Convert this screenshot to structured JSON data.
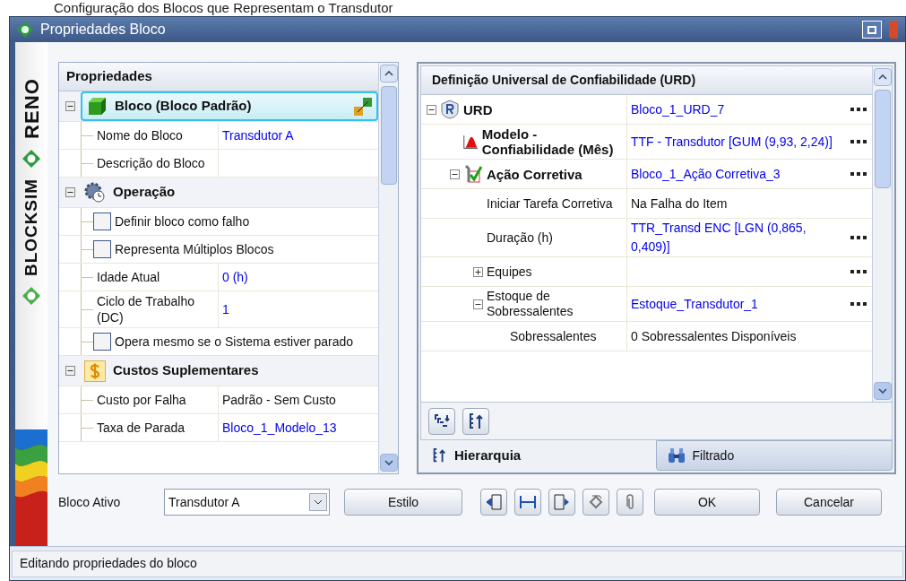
{
  "caption": "Configuração dos Blocos que Representam o Transdutor",
  "window": {
    "title": "Propriedades Bloco"
  },
  "brand": {
    "product": "BLOCKSIM",
    "company": "RENO"
  },
  "properties": {
    "header": "Propriedades",
    "categories": [
      {
        "kind": "block",
        "label": "Bloco (Bloco Padrão)",
        "expanded": true,
        "selected": true,
        "children": [
          {
            "kind": "property",
            "label": "Nome do Bloco",
            "value": "Transdutor A",
            "link": true
          },
          {
            "kind": "property",
            "label": "Descrição do Bloco"
          }
        ]
      },
      {
        "kind": "operation",
        "label": "Operação",
        "expanded": true,
        "selected": false,
        "children": [
          {
            "kind": "checkbox",
            "label": "Definir bloco como falho",
            "checked": false
          },
          {
            "kind": "checkbox",
            "label": "Representa Múltiplos Blocos",
            "checked": false
          },
          {
            "kind": "property",
            "label": "Idade Atual",
            "value": "0 (h)",
            "link": true
          },
          {
            "kind": "property",
            "label": "Ciclo de Trabalho (DC)",
            "value": "1",
            "link": true
          },
          {
            "kind": "checkbox",
            "label": "Opera mesmo se o Sistema estiver parado",
            "checked": false
          }
        ]
      },
      {
        "kind": "costs",
        "label": "Custos Suplementares",
        "expanded": true,
        "selected": false,
        "children": [
          {
            "kind": "property",
            "label": "Custo por Falha",
            "value": "Padrão - Sem Custo",
            "link": false
          },
          {
            "kind": "property",
            "label": "Taxa de Parada",
            "value": "Bloco_1_Modelo_13",
            "link": true
          }
        ]
      }
    ]
  },
  "urd": {
    "header": "Definição Universal de Confiabilidade (URD)",
    "tree": [
      {
        "kind": "urd",
        "label": "URD",
        "bold": true,
        "value": "Bloco_1_URD_7",
        "link": true,
        "more": true,
        "expanded": true,
        "children": [
          {
            "kind": "model",
            "label": "Modelo - Confiabilidade (Mês)",
            "bold": true,
            "value": "TTF - Transdutor [GUM (9,93, 2,24)]",
            "link": true,
            "more": true
          },
          {
            "kind": "action",
            "label": "Ação Corretiva",
            "bold": true,
            "value": "Bloco_1_Ação Corretiva_3",
            "link": true,
            "more": true,
            "expanded": true,
            "children": [
              {
                "label": "Iniciar Tarefa Corretiva",
                "bold": false,
                "value": "Na Falha do Item",
                "link": false,
                "more": false
              },
              {
                "label": "Duração (h)",
                "bold": false,
                "value": "TTR_Transd ENC [LGN (0,865, 0,409)]",
                "link": true,
                "more": true
              },
              {
                "label": "Equipes",
                "bold": false,
                "more": true,
                "expanded": false
              },
              {
                "label": "Estoque de Sobressalentes",
                "bold": false,
                "value": "Estoque_Transdutor_1",
                "link": true,
                "more": true,
                "expanded": true,
                "children": [
                  {
                    "label": "Sobressalentes",
                    "bold": false,
                    "value": "0 Sobressalentes Disponíveis",
                    "link": false,
                    "more": false
                  }
                ]
              }
            ]
          }
        ]
      }
    ],
    "tabs": [
      {
        "label": "Hierarquia",
        "selected": true
      },
      {
        "label": "Filtrado",
        "selected": false
      }
    ]
  },
  "footer": {
    "active_label": "Bloco Ativo",
    "active_value": "Transdutor A",
    "style_button": "Estilo",
    "ok": "OK",
    "cancel": "Cancelar"
  },
  "status_bar": "Editando propriedades do bloco"
}
